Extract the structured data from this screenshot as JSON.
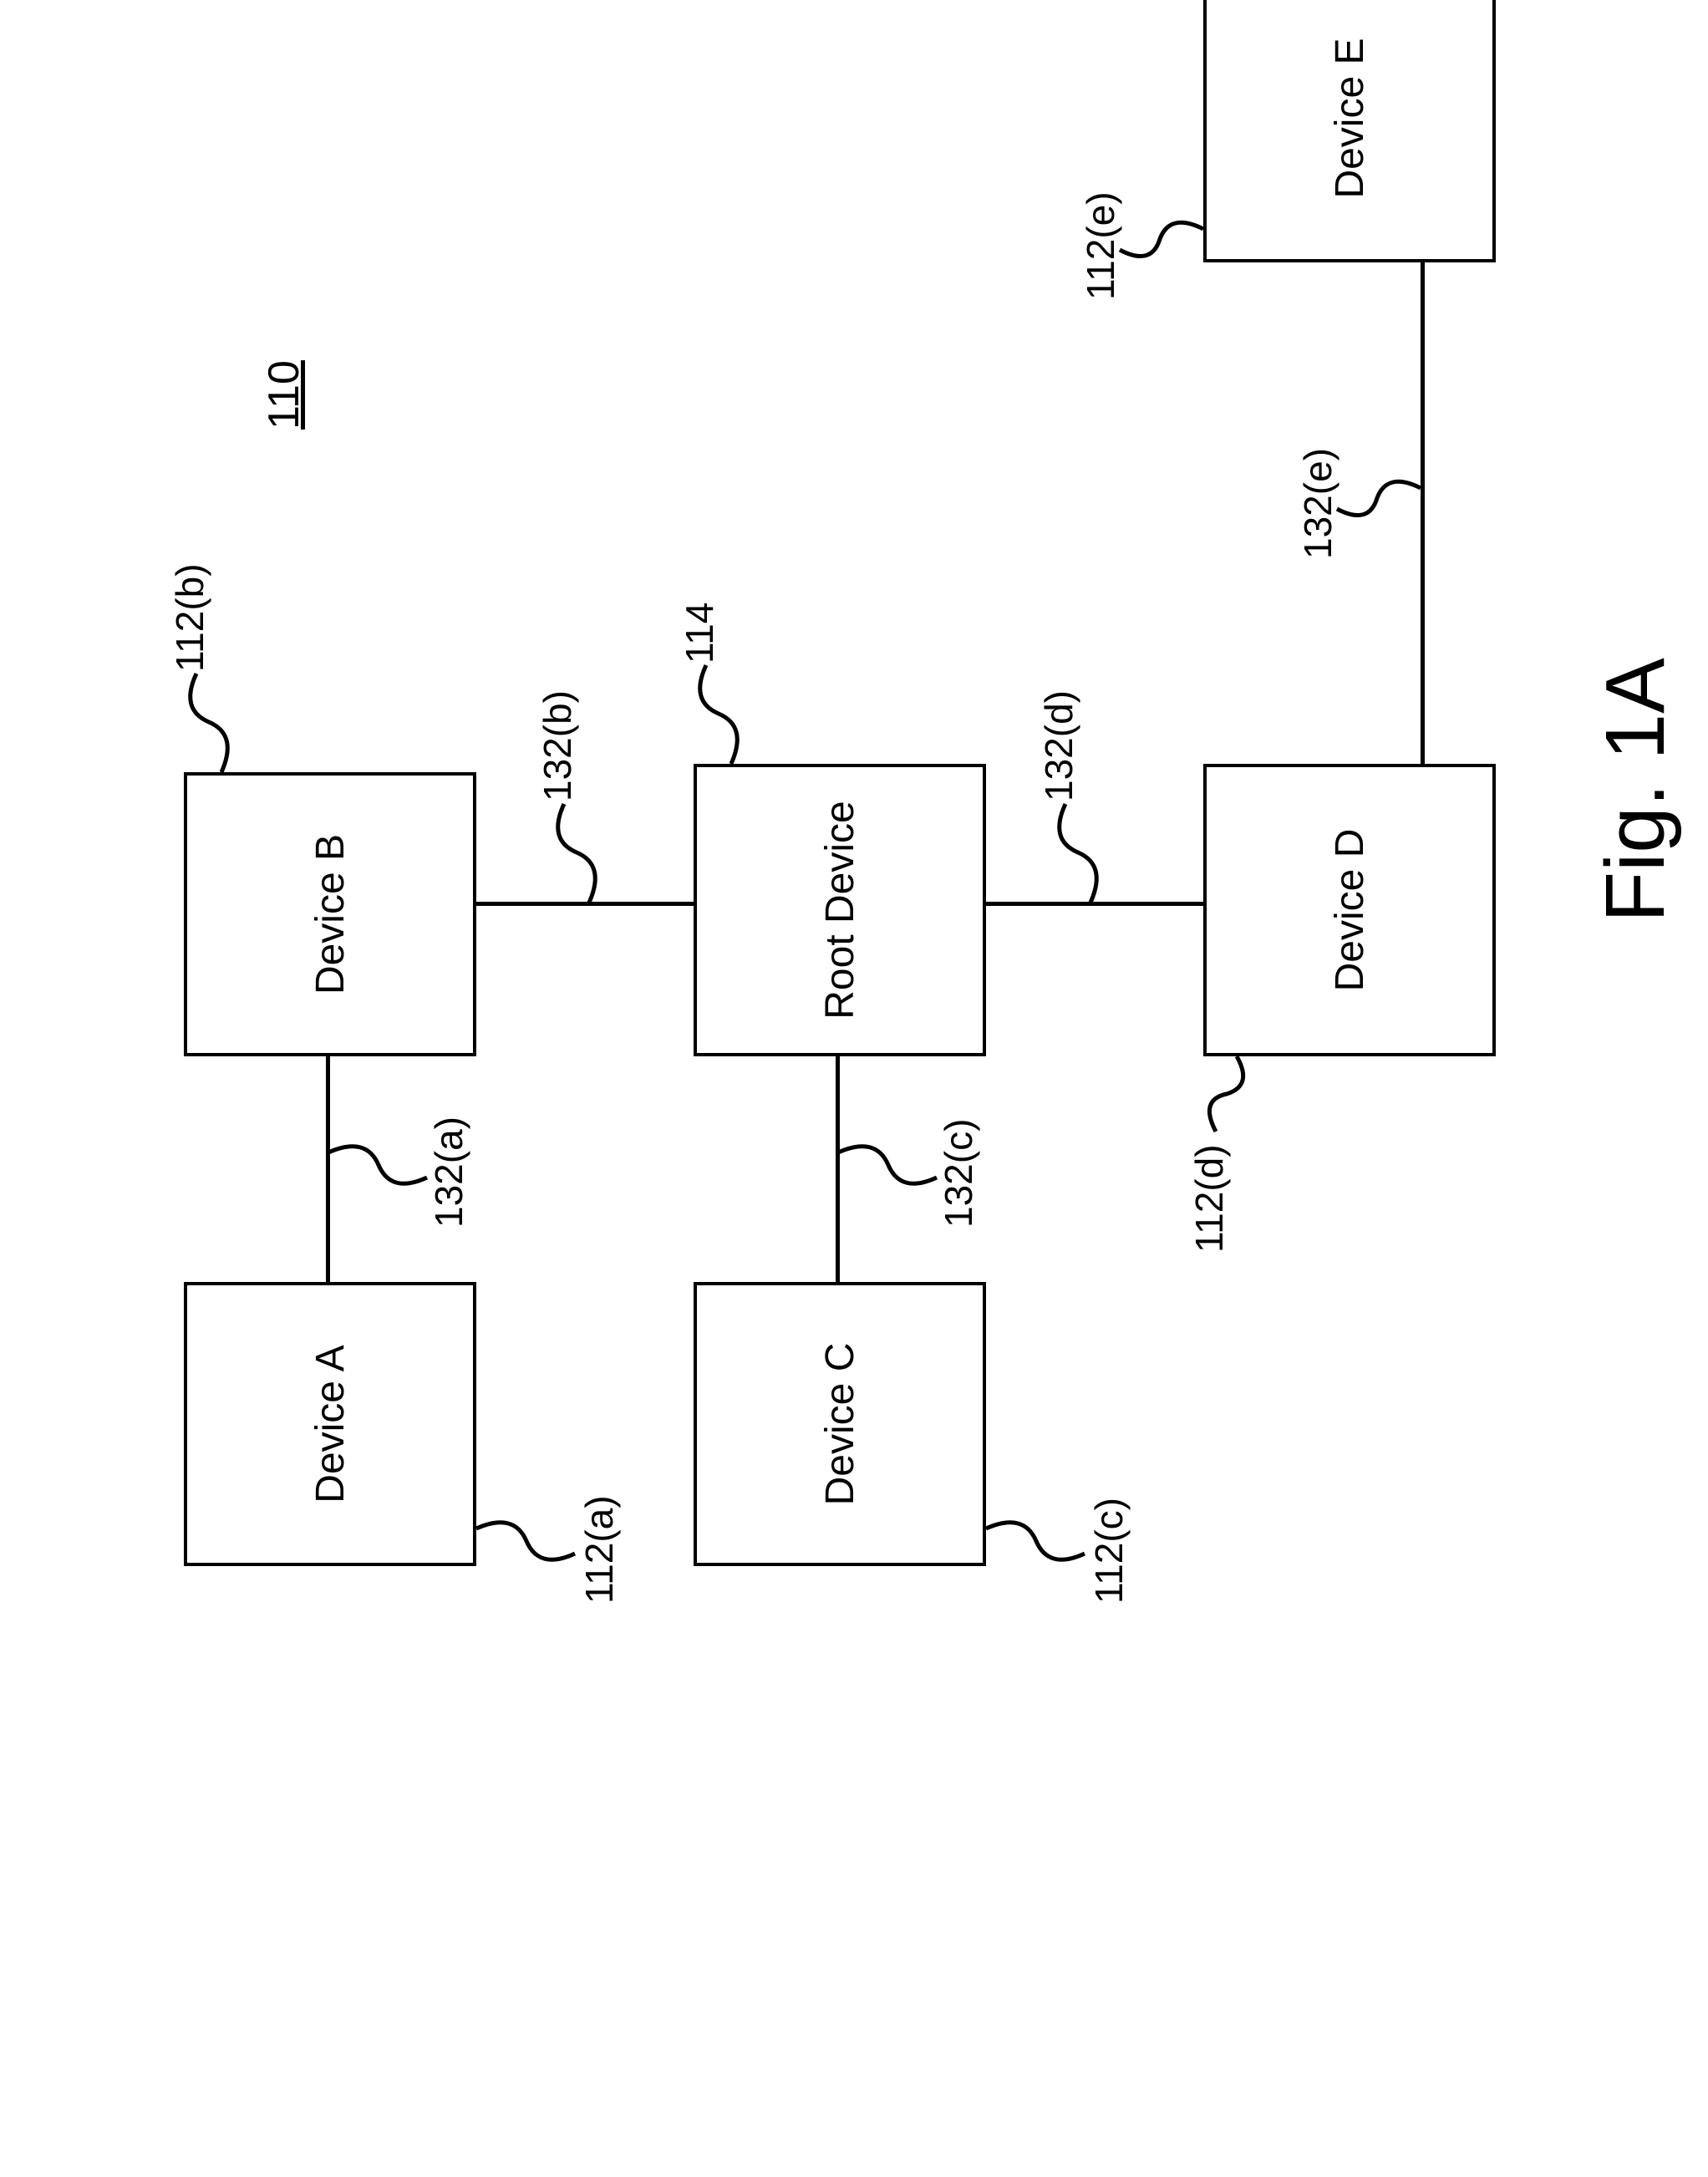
{
  "figureRef": "110",
  "figureLabel": "Fig. 1A",
  "boxes": {
    "deviceA": {
      "label": "Device A",
      "ref": "112(a)"
    },
    "deviceB": {
      "label": "Device B",
      "ref": "112(b)"
    },
    "deviceC": {
      "label": "Device C",
      "ref": "112(c)"
    },
    "deviceD": {
      "label": "Device D",
      "ref": "112(d)"
    },
    "deviceE": {
      "label": "Device E",
      "ref": "112(e)"
    },
    "root": {
      "label": "Root Device",
      "ref": "114"
    }
  },
  "connectors": {
    "ab": "132(a)",
    "br": "132(b)",
    "cr": "132(c)",
    "rd": "132(d)",
    "de": "132(e)"
  }
}
